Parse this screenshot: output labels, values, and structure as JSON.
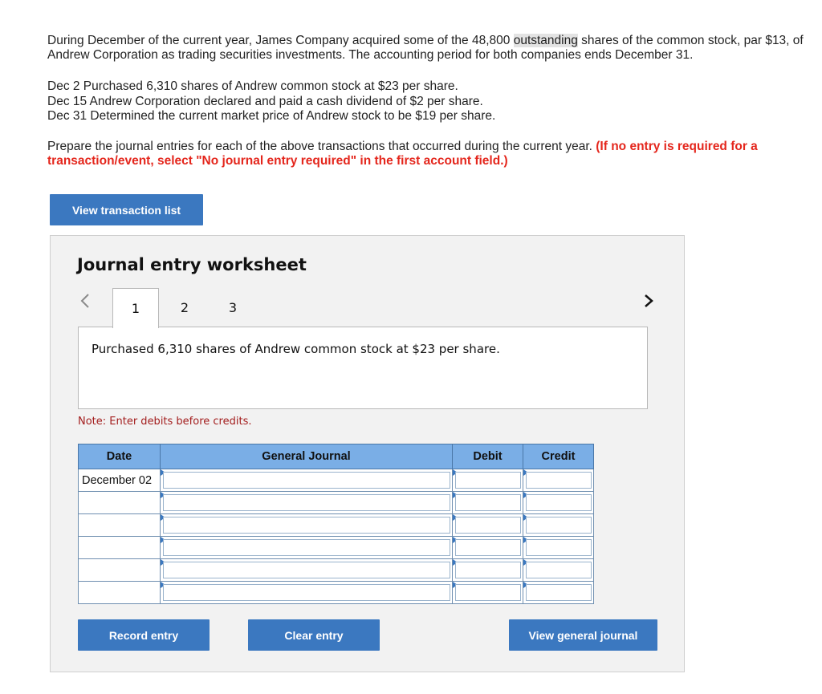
{
  "intro": {
    "part1": "During December of the current year, James Company acquired some of the 48,800 ",
    "highlight": "outstanding",
    "part2": " shares of the common stock, par $13, of Andrew Corporation as trading securities investments. The accounting period for both companies ends December 31."
  },
  "transactions": [
    "Dec 2 Purchased 6,310 shares of Andrew common stock at $23 per share.",
    "Dec 15 Andrew Corporation declared and paid a cash dividend of $2 per share.",
    "Dec 31 Determined the current market price of Andrew stock to be $19 per share."
  ],
  "instructions": {
    "text": "Prepare the journal entries for each of the above transactions that occurred during the current year. ",
    "emphasis": "(If no entry is required for a transaction/event, select \"No journal entry required\" in the first account field.)"
  },
  "view_transaction_list_label": "View transaction list",
  "worksheet": {
    "title": "Journal entry worksheet",
    "prev_icon": "chevron-left-icon",
    "next_icon": "chevron-right-icon",
    "tabs": [
      "1",
      "2",
      "3"
    ],
    "active_tab": "1",
    "description": "Purchased 6,310 shares of Andrew common stock at $23 per share.",
    "note": "Note: Enter debits before credits.",
    "columns": [
      "Date",
      "General Journal",
      "Debit",
      "Credit"
    ],
    "rows": [
      {
        "date": "December 02"
      },
      {
        "date": ""
      },
      {
        "date": ""
      },
      {
        "date": ""
      },
      {
        "date": ""
      },
      {
        "date": ""
      }
    ],
    "buttons": {
      "record": "Record entry",
      "clear": "Clear entry",
      "view_journal": "View general journal"
    }
  }
}
